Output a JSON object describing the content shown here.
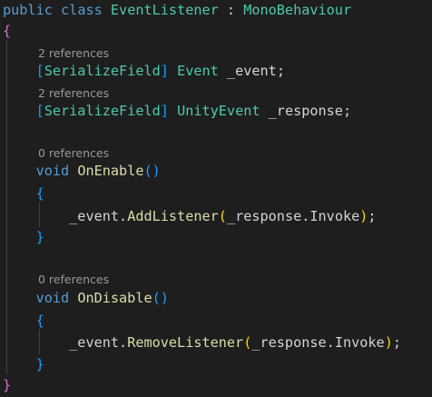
{
  "code": {
    "class_line": {
      "kw_public": "public",
      "kw_class": "class",
      "class_name": "EventListener",
      "colon": " : ",
      "base_class": "MonoBehaviour"
    },
    "open_brace": "{",
    "close_brace": "}",
    "lens_2a": "2 references",
    "field1": {
      "open": "[",
      "attr": "SerializeField",
      "close": "]",
      "type": "Event",
      "name": "_event",
      "end": ";"
    },
    "lens_2b": "2 references",
    "field2": {
      "open": "[",
      "attr": "SerializeField",
      "close": "]",
      "type": "UnityEvent",
      "name": "_response",
      "end": ";"
    },
    "lens_0a": "0 references",
    "method1": {
      "kw": "void",
      "name": "OnEnable",
      "open_paren": "(",
      "close_paren": ")",
      "open_brace": "{",
      "close_brace": "}",
      "body": {
        "target": "_event",
        "dot1": ".",
        "call": "AddListener",
        "open_paren": "(",
        "arg_obj": "_response",
        "dot2": ".",
        "arg_member": "Invoke",
        "close_paren": ")",
        "end": ";"
      }
    },
    "lens_0b": "0 references",
    "method2": {
      "kw": "void",
      "name": "OnDisable",
      "open_paren": "(",
      "close_paren": ")",
      "open_brace": "{",
      "close_brace": "}",
      "body": {
        "target": "_event",
        "dot1": ".",
        "call": "RemoveListener",
        "open_paren": "(",
        "arg_obj": "_response",
        "dot2": ".",
        "arg_member": "Invoke",
        "close_paren": ")",
        "end": ";"
      }
    }
  },
  "colors": {
    "background": "#1e1e1e",
    "keyword": "#569cd6",
    "type": "#4ec9b0",
    "function": "#dcdcaa",
    "text": "#d4d4d4",
    "codelens": "#999999",
    "bracket_level1": "#da70d6",
    "bracket_level2": "#179fff",
    "bracket_level3": "#ffd700"
  }
}
